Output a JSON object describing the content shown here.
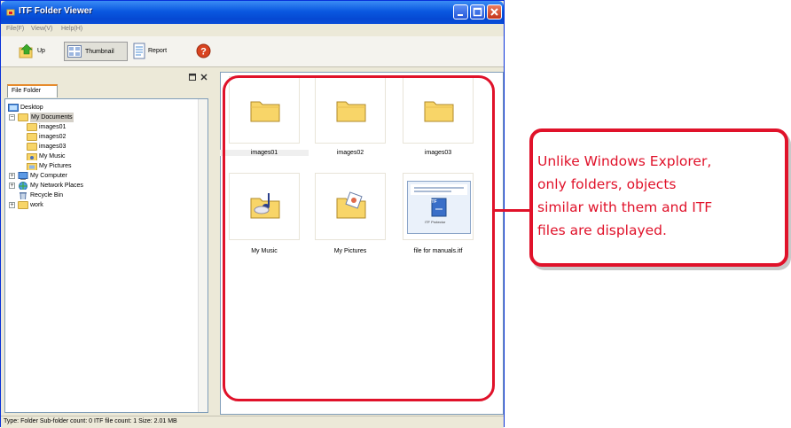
{
  "window": {
    "title": "ITF Folder Viewer"
  },
  "menu": [
    "File(F)",
    "View(V)",
    "Help(H)"
  ],
  "toolbar": {
    "up": "Up",
    "thumbnail": "Thumbnail",
    "report": "Report"
  },
  "tabs": [
    "File Folder"
  ],
  "tree": {
    "desktop": "Desktop",
    "my_documents": "My Documents",
    "images01": "images01",
    "images02": "images02",
    "images03": "images03",
    "my_music": "My Music",
    "my_pictures": "My Pictures",
    "my_computer": "My Computer",
    "my_network_places": "My Network Places",
    "recycle_bin": "Recycle Bin",
    "work": "work"
  },
  "thumbnails": [
    "images01",
    "images02",
    "images03",
    "My Music",
    "My Pictures",
    "file for manuals.itf"
  ],
  "itf_preview": {
    "badge": "ITF",
    "caption": "ITF Protector"
  },
  "status": "Type: Folder Sub-folder count: 0  ITF file count: 1  Size: 2.01 MB",
  "callout": [
    "Unlike Windows Explorer,",
    "only folders, objects",
    "similar with them and ITF",
    "files are displayed."
  ],
  "colors": {
    "accent": "#E0122A",
    "titlebar": "#0A58E0",
    "folder": "#F8D568"
  }
}
